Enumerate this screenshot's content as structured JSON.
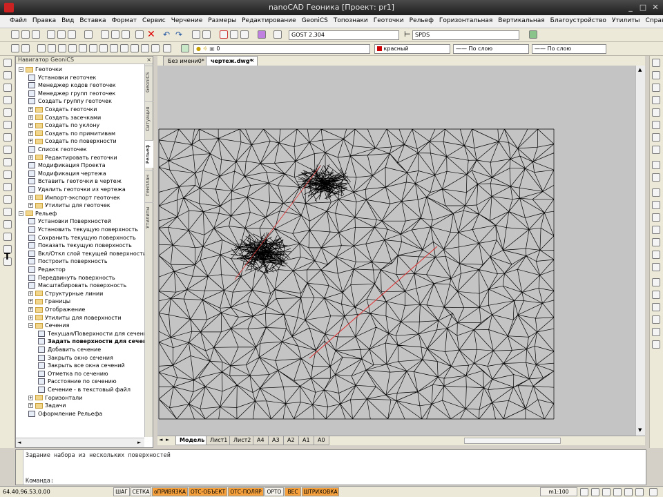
{
  "window": {
    "title": "nanoCAD Геоника [Проект: pr1]",
    "controls": [
      "_",
      "□",
      "✕"
    ]
  },
  "menu": [
    "Файл",
    "Правка",
    "Вид",
    "Вставка",
    "Формат",
    "Сервис",
    "Черчение",
    "Размеры",
    "Редактирование",
    "GeoniCS",
    "Топознаки",
    "Геоточки",
    "Рельеф",
    "Горизонтальная",
    "Вертикальная",
    "Благоустройство",
    "Утилиты",
    "Справка"
  ],
  "toolbar": {
    "text_style": "GOST 2.304",
    "dim_style": "SPDS",
    "layer": "0",
    "color": "красный",
    "linetype": "По слою",
    "lineweight": "По слою",
    "color_swatch": "#cc0000"
  },
  "navigator": {
    "title": "Навигатор GeoniCS",
    "close": "×",
    "vtabs": [
      "GeoniCS",
      "Ситуация",
      "Рельеф",
      "Генплан",
      "Утилиты"
    ],
    "active_vtab": "Рельеф",
    "tree": [
      {
        "label": "Геоточки",
        "level": 0,
        "kind": "folder",
        "exp": "−"
      },
      {
        "label": "Установки геоточек",
        "level": 1,
        "kind": "item"
      },
      {
        "label": "Менеджер кодов геоточек",
        "level": 1,
        "kind": "item"
      },
      {
        "label": "Менеджер групп геоточек",
        "level": 1,
        "kind": "item"
      },
      {
        "label": "Создать группу геоточек",
        "level": 1,
        "kind": "item"
      },
      {
        "label": "Создать геоточки",
        "level": 1,
        "kind": "folder",
        "exp": "+"
      },
      {
        "label": "Создать засечками",
        "level": 1,
        "kind": "folder",
        "exp": "+"
      },
      {
        "label": "Создать по уклону",
        "level": 1,
        "kind": "folder",
        "exp": "+"
      },
      {
        "label": "Создать по примитивам",
        "level": 1,
        "kind": "folder",
        "exp": "+"
      },
      {
        "label": "Создать по поверхности",
        "level": 1,
        "kind": "folder",
        "exp": "+"
      },
      {
        "label": "Список геоточек",
        "level": 1,
        "kind": "item"
      },
      {
        "label": "Редактировать геоточки",
        "level": 1,
        "kind": "folder",
        "exp": "+"
      },
      {
        "label": "Модификация Проекта",
        "level": 1,
        "kind": "item"
      },
      {
        "label": "Модификация чертежа",
        "level": 1,
        "kind": "item"
      },
      {
        "label": "Вставить геоточки в чертеж",
        "level": 1,
        "kind": "item"
      },
      {
        "label": "Удалить геоточки из чертежа",
        "level": 1,
        "kind": "item"
      },
      {
        "label": "Импорт-экспорт геоточек",
        "level": 1,
        "kind": "folder",
        "exp": "+"
      },
      {
        "label": "Утилиты для геоточек",
        "level": 1,
        "kind": "folder",
        "exp": "+"
      },
      {
        "label": "Рельеф",
        "level": 0,
        "kind": "folder",
        "exp": "−"
      },
      {
        "label": "Установки Поверхностей",
        "level": 1,
        "kind": "item"
      },
      {
        "label": "Установить текущую поверхность",
        "level": 1,
        "kind": "item"
      },
      {
        "label": "Сохранить текущую поверхность",
        "level": 1,
        "kind": "item"
      },
      {
        "label": "Показать текущую поверхность",
        "level": 1,
        "kind": "item"
      },
      {
        "label": "Вкл/Откл слой текущей поверхности",
        "level": 1,
        "kind": "item"
      },
      {
        "label": "Построить поверхность",
        "level": 1,
        "kind": "item"
      },
      {
        "label": "Редактор",
        "level": 1,
        "kind": "item"
      },
      {
        "label": "Передвинуть поверхность",
        "level": 1,
        "kind": "item"
      },
      {
        "label": "Масштабировать поверхность",
        "level": 1,
        "kind": "item"
      },
      {
        "label": "Структурные линии",
        "level": 1,
        "kind": "folder",
        "exp": "+"
      },
      {
        "label": "Границы",
        "level": 1,
        "kind": "folder",
        "exp": "+"
      },
      {
        "label": "Отображение",
        "level": 1,
        "kind": "folder",
        "exp": "+"
      },
      {
        "label": "Утилиты для поверхности",
        "level": 1,
        "kind": "folder",
        "exp": "+"
      },
      {
        "label": "Сечения",
        "level": 1,
        "kind": "folder",
        "exp": "−"
      },
      {
        "label": "Текущая/Поверхности для сечения",
        "level": 2,
        "kind": "item"
      },
      {
        "label": "Задать поверхности для сечения",
        "level": 2,
        "kind": "item",
        "selected": true
      },
      {
        "label": "Добавить сечение",
        "level": 2,
        "kind": "item"
      },
      {
        "label": "Закрыть окно сечения",
        "level": 2,
        "kind": "item"
      },
      {
        "label": "Закрыть все окна сечений",
        "level": 2,
        "kind": "item"
      },
      {
        "label": "Отметка по сечению",
        "level": 2,
        "kind": "item"
      },
      {
        "label": "Расстояние по сечению",
        "level": 2,
        "kind": "item"
      },
      {
        "label": "Сечение - в текстовый файл",
        "level": 2,
        "kind": "item"
      },
      {
        "label": "Горизонтали",
        "level": 1,
        "kind": "folder",
        "exp": "+"
      },
      {
        "label": "Задачи",
        "level": 1,
        "kind": "folder",
        "exp": "+"
      },
      {
        "label": "Оформление Рельефа",
        "level": 1,
        "kind": "item"
      }
    ]
  },
  "doc_tabs": [
    "Без имени0*",
    "чертеж.dwg*"
  ],
  "active_doc_tab": "чертеж.dwg*",
  "layout_tabs": [
    "Модель",
    "Лист1",
    "Лист2",
    "A4",
    "A3",
    "A2",
    "A1",
    "A0"
  ],
  "active_layout_tab": "Модель",
  "command": {
    "history": "Задание набора из нескольких поверхностей",
    "prompt": "Команда:"
  },
  "status": {
    "coords": "64.40,96.53,0.00",
    "buttons": [
      {
        "label": "ШАГ",
        "on": false
      },
      {
        "label": "СЕТКА",
        "on": false
      },
      {
        "label": "оПРИВЯЗКА",
        "on": true
      },
      {
        "label": "ОТС-ОБЪЕКТ",
        "on": true
      },
      {
        "label": "ОТС-ПОЛЯР",
        "on": true
      },
      {
        "label": "ОРТО",
        "on": false
      },
      {
        "label": "ВЕС",
        "on": true
      },
      {
        "label": "ШТРИХОВКА",
        "on": true
      }
    ],
    "scale": "m1:100"
  },
  "colors": {
    "canvas_bg": "#c4c4c4",
    "mesh_line": "#000000",
    "section_line": "#e03030",
    "status_on": "#f6a13c"
  }
}
